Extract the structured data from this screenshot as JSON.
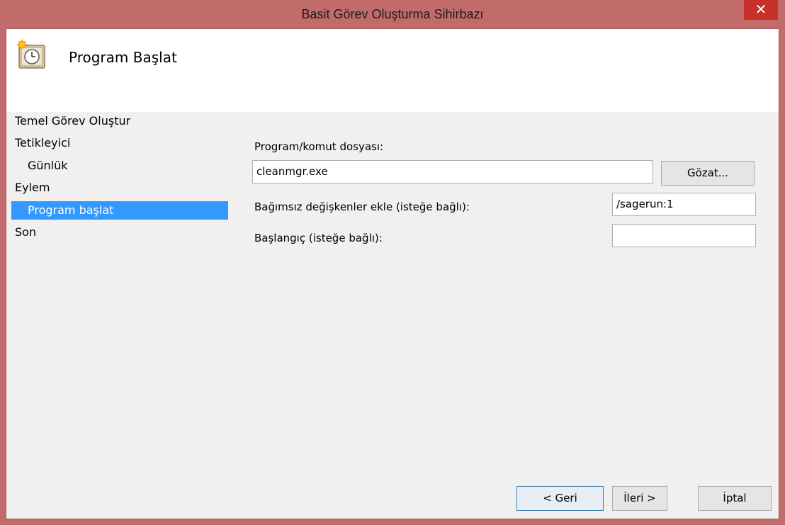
{
  "window": {
    "title": "Basit Görev Oluşturma Sihirbazı",
    "close_glyph": "✕"
  },
  "header": {
    "icon": "task-scheduler-clock-icon",
    "title": "Program Başlat"
  },
  "nav": {
    "items": [
      {
        "label": "Temel Görev Oluştur",
        "level": 0,
        "selected": false
      },
      {
        "label": "Tetikleyici",
        "level": 0,
        "selected": false
      },
      {
        "label": "Günlük",
        "level": 1,
        "selected": false
      },
      {
        "label": "Eylem",
        "level": 0,
        "selected": false
      },
      {
        "label": "Program başlat",
        "level": 1,
        "selected": true
      },
      {
        "label": "Son",
        "level": 0,
        "selected": false
      }
    ]
  },
  "form": {
    "program_label": "Program/komut dosyası:",
    "program_value": "cleanmgr.exe",
    "browse_label": "Gözat...",
    "args_label": "Bağımsız değişkenler ekle (isteğe bağlı):",
    "args_value": "/sagerun:1",
    "startin_label": "Başlangıç (isteğe bağlı):",
    "startin_value": ""
  },
  "footer": {
    "back_label": "< Geri",
    "next_label": "İleri >",
    "cancel_label": "İptal"
  },
  "colors": {
    "frame": "#c26b6b",
    "close_button": "#c7312a",
    "selection": "#3399ff"
  }
}
